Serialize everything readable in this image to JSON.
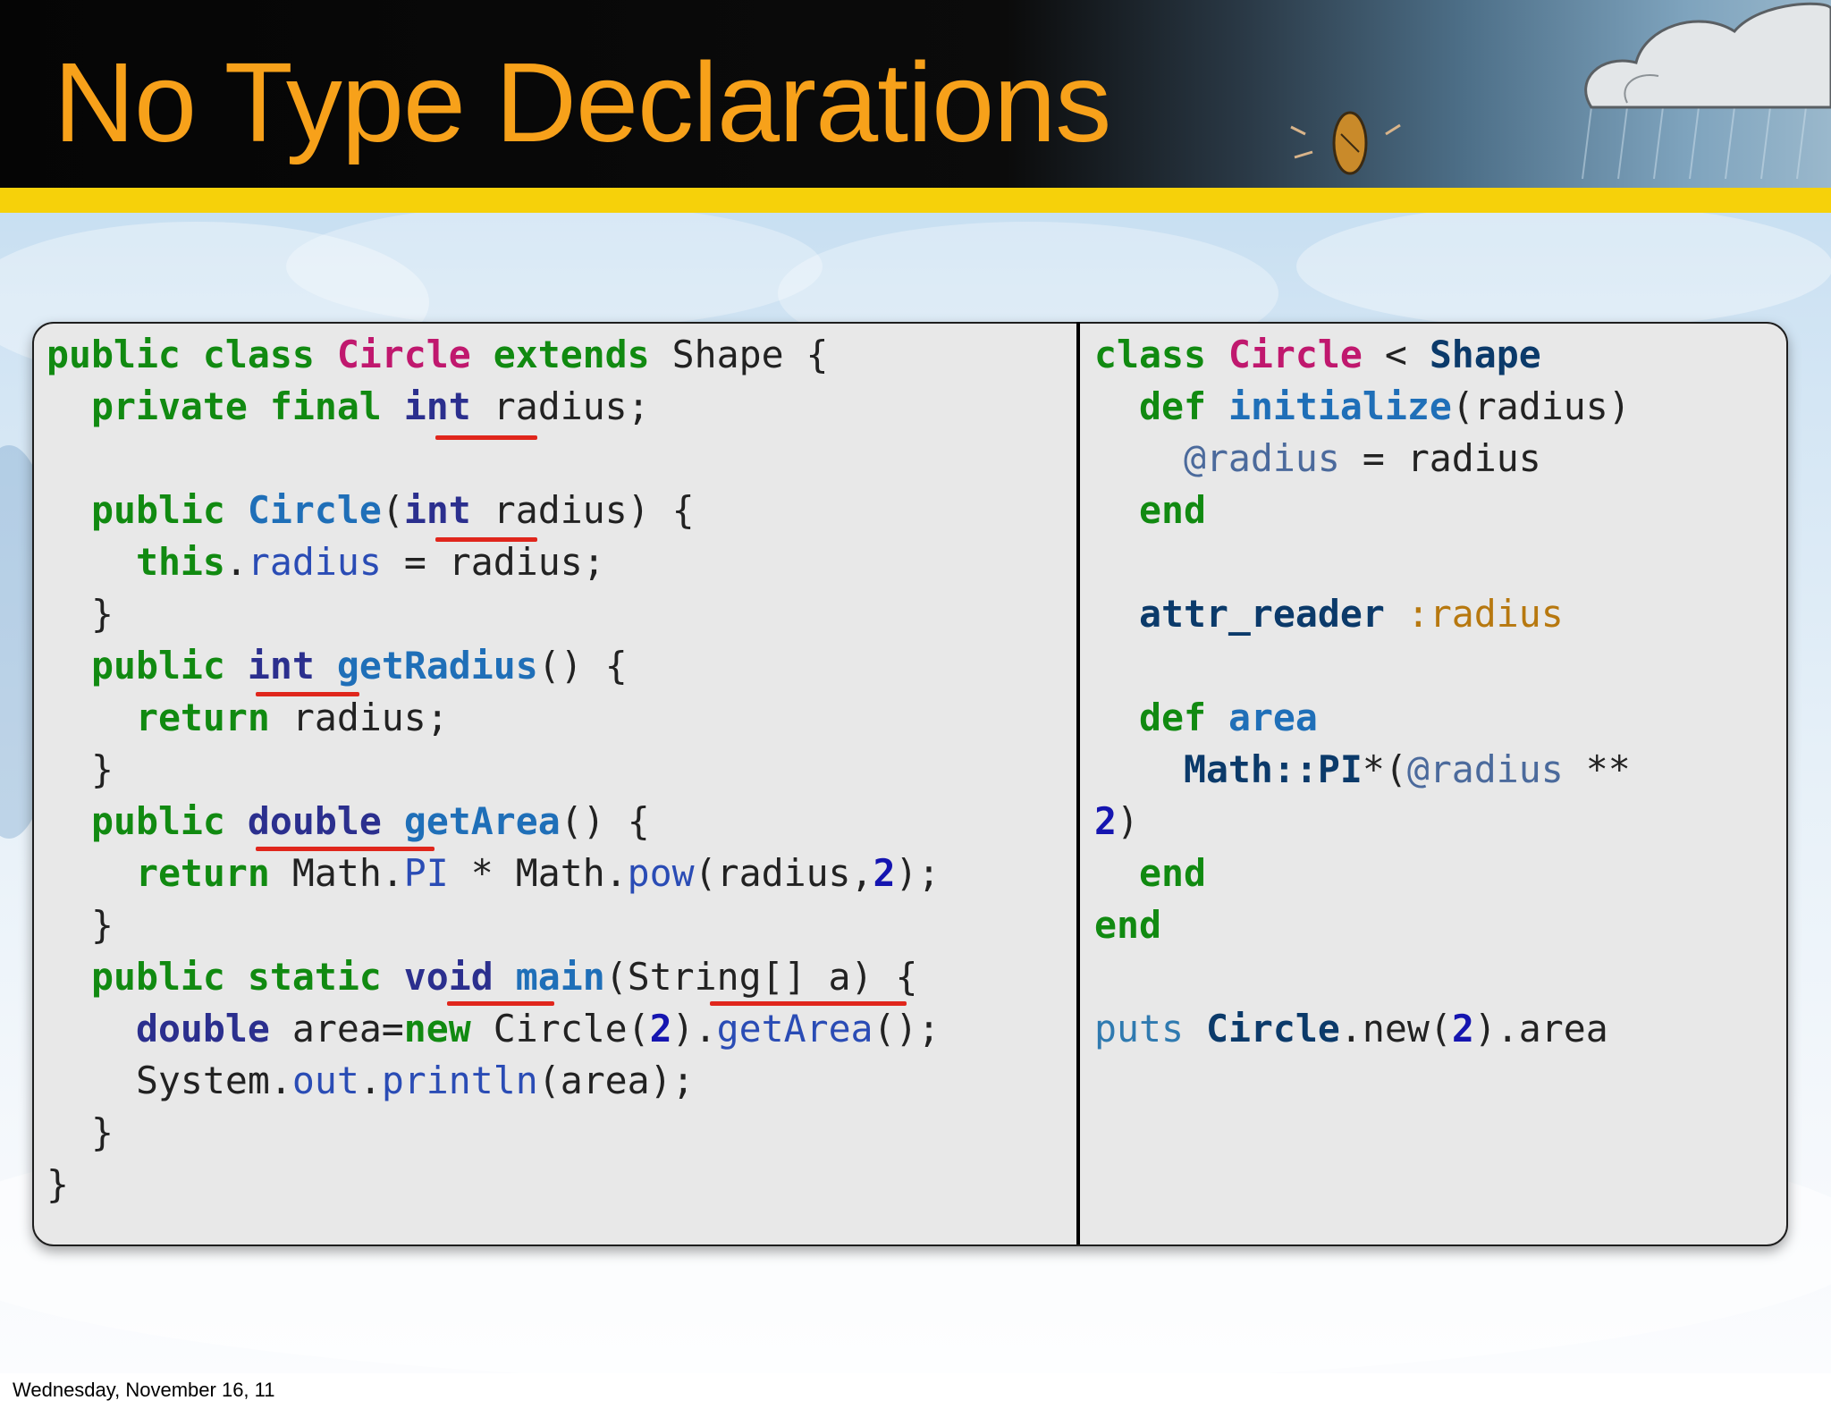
{
  "slide": {
    "title": "No Type Declarations",
    "footer_date": "Wednesday, November 16, 11"
  },
  "colors": {
    "title": "#f7a11a",
    "header_bg": "#050505",
    "band": "#f6d10a",
    "keyword": "#118a11",
    "class_name": "#c0186e",
    "type": "#2b2f8e",
    "method": "#1f6fb8",
    "number": "#1515b0",
    "symbol": "#b7780f",
    "underline": "#e0261c"
  },
  "java_code": {
    "lines": [
      [
        [
          "public class ",
          "kw"
        ],
        [
          "Circle",
          "cls"
        ],
        [
          " ",
          ""
        ],
        [
          "extends",
          "kw"
        ],
        [
          " Shape {",
          ""
        ]
      ],
      [
        [
          "  ",
          ""
        ],
        [
          "private final",
          "kw"
        ],
        [
          " ",
          ""
        ],
        [
          "int",
          "typ"
        ],
        [
          " radius;",
          ""
        ]
      ],
      [
        [
          "",
          ""
        ]
      ],
      [
        [
          "  ",
          ""
        ],
        [
          "public",
          "kw"
        ],
        [
          " ",
          ""
        ],
        [
          "Circle",
          "fn"
        ],
        [
          "(",
          ""
        ],
        [
          "int",
          "typ"
        ],
        [
          " radius) {",
          ""
        ]
      ],
      [
        [
          "    ",
          ""
        ],
        [
          "this",
          "kw"
        ],
        [
          ".",
          ""
        ],
        [
          "radius",
          "fld"
        ],
        [
          " = radius;",
          ""
        ]
      ],
      [
        [
          "  }",
          ""
        ]
      ],
      [
        [
          "  ",
          ""
        ],
        [
          "public",
          "kw"
        ],
        [
          " ",
          ""
        ],
        [
          "int",
          "typ"
        ],
        [
          " ",
          ""
        ],
        [
          "getRadius",
          "fn"
        ],
        [
          "() {",
          ""
        ]
      ],
      [
        [
          "    ",
          ""
        ],
        [
          "return",
          "kw"
        ],
        [
          " radius;",
          ""
        ]
      ],
      [
        [
          "  }",
          ""
        ]
      ],
      [
        [
          "  ",
          ""
        ],
        [
          "public",
          "kw"
        ],
        [
          " ",
          ""
        ],
        [
          "double",
          "typ"
        ],
        [
          " ",
          ""
        ],
        [
          "getArea",
          "fn"
        ],
        [
          "() {",
          ""
        ]
      ],
      [
        [
          "    ",
          ""
        ],
        [
          "return",
          "kw"
        ],
        [
          " Math.",
          ""
        ],
        [
          "PI",
          "fld"
        ],
        [
          " * Math.",
          ""
        ],
        [
          "pow",
          "fld"
        ],
        [
          "(radius,",
          ""
        ],
        [
          "2",
          "num"
        ],
        [
          ");",
          ""
        ]
      ],
      [
        [
          "  }",
          ""
        ]
      ],
      [
        [
          "  ",
          ""
        ],
        [
          "public static",
          "kw"
        ],
        [
          " ",
          ""
        ],
        [
          "void",
          "typ"
        ],
        [
          " ",
          ""
        ],
        [
          "main",
          "fn"
        ],
        [
          "(String[] a) {",
          ""
        ]
      ],
      [
        [
          "    ",
          ""
        ],
        [
          "double",
          "typ"
        ],
        [
          " area=",
          ""
        ],
        [
          "new",
          "kw"
        ],
        [
          " Circle(",
          ""
        ],
        [
          "2",
          "num"
        ],
        [
          ").",
          ""
        ],
        [
          "getArea",
          "fld"
        ],
        [
          "();",
          ""
        ]
      ],
      [
        [
          "    System.",
          ""
        ],
        [
          "out",
          "fld"
        ],
        [
          ".",
          ""
        ],
        [
          "println",
          "fld"
        ],
        [
          "(area);",
          ""
        ]
      ],
      [
        [
          "  }",
          ""
        ]
      ],
      [
        [
          "}",
          ""
        ]
      ]
    ]
  },
  "ruby_code": {
    "lines": [
      [
        [
          "class ",
          "kw"
        ],
        [
          "Circle",
          "cls"
        ],
        [
          " < ",
          ""
        ],
        [
          "Shape",
          "cst"
        ]
      ],
      [
        [
          "  ",
          ""
        ],
        [
          "def",
          "kw"
        ],
        [
          " ",
          ""
        ],
        [
          "initialize",
          "fn"
        ],
        [
          "(radius)",
          ""
        ]
      ],
      [
        [
          "    ",
          ""
        ],
        [
          "@radius",
          "ivar"
        ],
        [
          " = radius",
          ""
        ]
      ],
      [
        [
          "  ",
          ""
        ],
        [
          "end",
          "kw"
        ]
      ],
      [
        [
          "",
          ""
        ]
      ],
      [
        [
          "  ",
          ""
        ],
        [
          "attr_reader",
          "cst"
        ],
        [
          " ",
          ""
        ],
        [
          ":radius",
          "sym"
        ]
      ],
      [
        [
          "",
          ""
        ]
      ],
      [
        [
          "  ",
          ""
        ],
        [
          "def",
          "kw"
        ],
        [
          " ",
          ""
        ],
        [
          "area",
          "fn"
        ]
      ],
      [
        [
          "    ",
          ""
        ],
        [
          "Math::PI",
          "cst"
        ],
        [
          "*(",
          ""
        ],
        [
          "@radius",
          "ivar"
        ],
        [
          " **",
          ""
        ]
      ],
      [
        [
          "2",
          "num"
        ],
        [
          ")",
          ""
        ]
      ],
      [
        [
          "  ",
          ""
        ],
        [
          "end",
          "kw"
        ]
      ],
      [
        [
          "end",
          "kw"
        ]
      ],
      [
        [
          "",
          ""
        ]
      ],
      [
        [
          "puts",
          "mth"
        ],
        [
          " ",
          ""
        ],
        [
          "Circle",
          "cst"
        ],
        [
          ".new(",
          ""
        ],
        [
          "2",
          "num"
        ],
        [
          ").area",
          ""
        ]
      ]
    ]
  }
}
